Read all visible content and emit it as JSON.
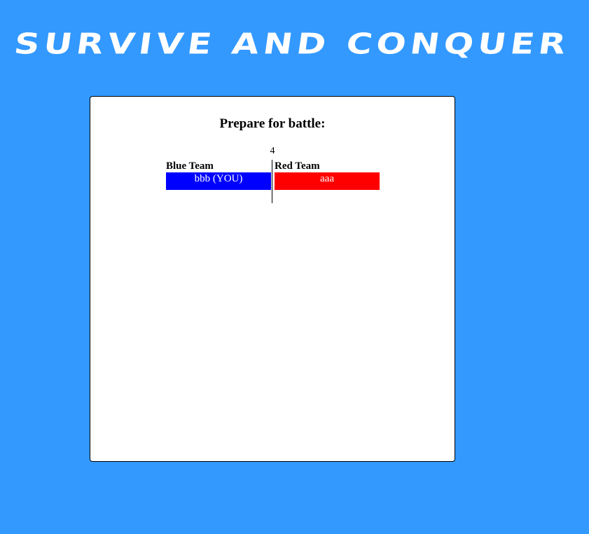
{
  "logo": {
    "text": "SURVIVE AND CONQUER"
  },
  "lobby": {
    "heading": "Prepare for battle:",
    "countdown": "4",
    "blue_team": {
      "title": "Blue Team",
      "players": [
        "bbb (YOU)"
      ],
      "color": "#0000ff"
    },
    "red_team": {
      "title": "Red Team",
      "players": [
        "aaa"
      ],
      "color": "#ff0000"
    }
  },
  "colors": {
    "background": "#3399ff",
    "panel": "#ffffff"
  }
}
